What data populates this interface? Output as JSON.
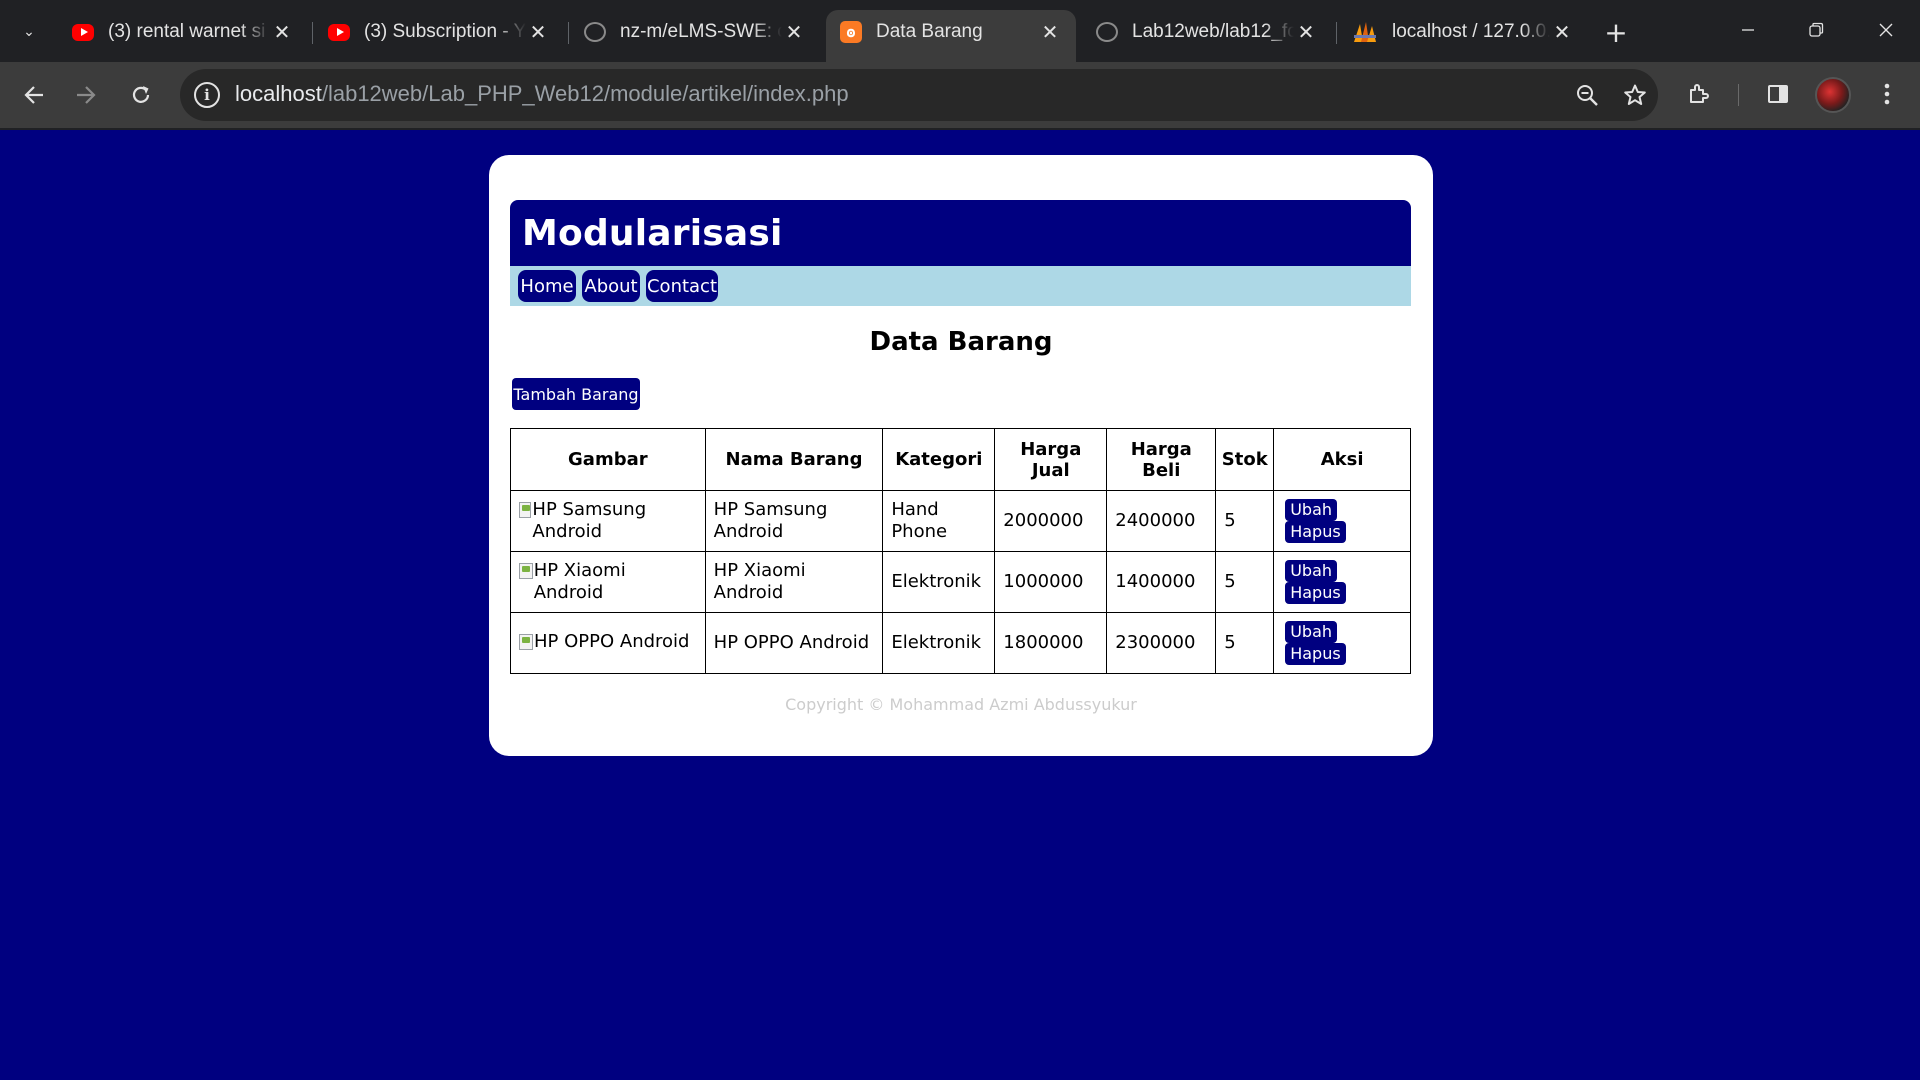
{
  "browser": {
    "tabs": [
      {
        "title": "(3) rental warnet si",
        "favicon": "youtube-icon",
        "active": false
      },
      {
        "title": "(3) Subscription - Y",
        "favicon": "youtube-icon",
        "active": false
      },
      {
        "title": "nz-m/eLMS-SWE: c",
        "favicon": "github-icon",
        "active": false
      },
      {
        "title": "Data Barang",
        "favicon": "xampp-icon",
        "active": true
      },
      {
        "title": "Lab12web/lab12_fo",
        "favicon": "github-icon",
        "active": false
      },
      {
        "title": "localhost / 127.0.0.",
        "favicon": "phpmyadmin-icon",
        "active": false
      }
    ],
    "url_host": "localhost",
    "url_path": "/lab12web/Lab_PHP_Web12/module/artikel/index.php"
  },
  "page": {
    "site_title": "Modularisasi",
    "nav": [
      "Home",
      "About",
      "Contact"
    ],
    "heading": "Data Barang",
    "add_button": "Tambah Barang",
    "table": {
      "headers": [
        "Gambar",
        "Nama Barang",
        "Kategori",
        "Harga Jual",
        "Harga Beli",
        "Stok",
        "Aksi"
      ],
      "rows": [
        {
          "gambar_alt": "HP Samsung Android",
          "nama": "HP Samsung Android",
          "kategori": "Hand Phone",
          "harga_jual": "2000000",
          "harga_beli": "2400000",
          "stok": "5"
        },
        {
          "gambar_alt": "HP Xiaomi Android",
          "nama": "HP Xiaomi Android",
          "kategori": "Elektronik",
          "harga_jual": "1000000",
          "harga_beli": "1400000",
          "stok": "5"
        },
        {
          "gambar_alt": "HP OPPO Android",
          "nama": "HP OPPO Android",
          "kategori": "Elektronik",
          "harga_jual": "1800000",
          "harga_beli": "2300000",
          "stok": "5"
        }
      ],
      "edit_label": "Ubah",
      "delete_label": "Hapus"
    },
    "footer": "Copyright © Mohammad Azmi Abdussyukur",
    "colors": {
      "background": "#000080",
      "nav_bar": "#add8e6",
      "footer_text": "#cccccc"
    }
  }
}
